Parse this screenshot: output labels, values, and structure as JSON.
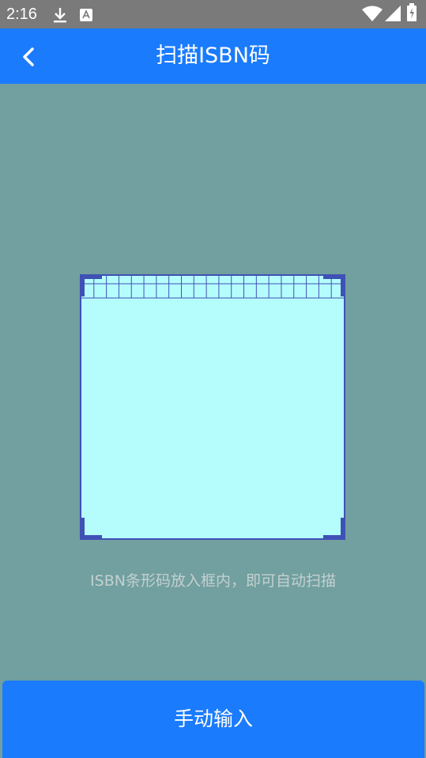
{
  "status_bar": {
    "time": "2:16",
    "icons": [
      "download-icon",
      "app-a-icon",
      "wifi-icon",
      "signal-icon",
      "battery-icon"
    ]
  },
  "header": {
    "title": "扫描ISBN码",
    "back_icon": "chevron-left-icon"
  },
  "scanner": {
    "hint": "ISBN条形码放入框内，即可自动扫描"
  },
  "footer": {
    "manual_input_label": "手动输入"
  },
  "colors": {
    "primary": "#1a7bfd",
    "background": "#729f9f",
    "scan_area": "#b4fdfc",
    "frame_border": "#3f51b5",
    "status_bar": "#7a7a7a"
  }
}
